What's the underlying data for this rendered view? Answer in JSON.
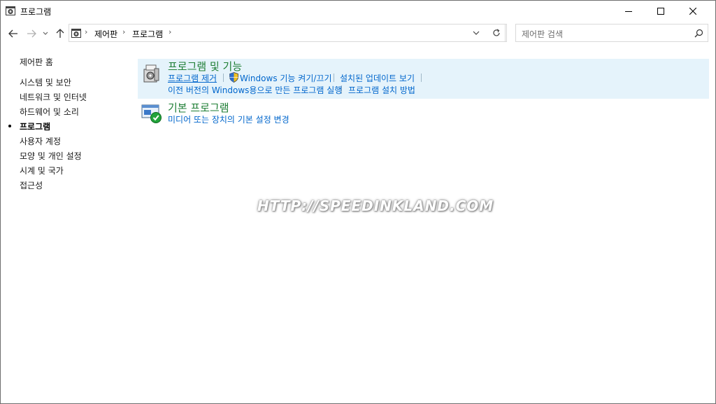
{
  "window": {
    "title": "프로그램"
  },
  "address": {
    "crumbs": [
      "제어판",
      "프로그램"
    ]
  },
  "search": {
    "placeholder": "제어판 검색"
  },
  "leftnav": {
    "home": "제어판 홈",
    "items": [
      {
        "label": "시스템 및 보안",
        "active": false
      },
      {
        "label": "네트워크 및 인터넷",
        "active": false
      },
      {
        "label": "하드웨어 및 소리",
        "active": false
      },
      {
        "label": "프로그램",
        "active": true
      },
      {
        "label": "사용자 계정",
        "active": false
      },
      {
        "label": "모양 및 개인 설정",
        "active": false
      },
      {
        "label": "시계 및 국가",
        "active": false
      },
      {
        "label": "접근성",
        "active": false
      }
    ]
  },
  "main": {
    "categories": [
      {
        "title": "프로그램 및 기능",
        "links": [
          "프로그램 제거",
          "Windows 기능 켜기/끄기",
          "설치된 업데이트 보기",
          "이전 버전의 Windows용으로 만든 프로그램 실행",
          "프로그램 설치 방법"
        ]
      },
      {
        "title": "기본 프로그램",
        "links": [
          "미디어 또는 장치의 기본 설정 변경"
        ]
      }
    ]
  },
  "watermark": "HTTP://SPEEDINKLAND.COM",
  "colors": {
    "category_title": "#1e7e34",
    "link": "#0066cc",
    "highlight": "#e5f3fb"
  }
}
